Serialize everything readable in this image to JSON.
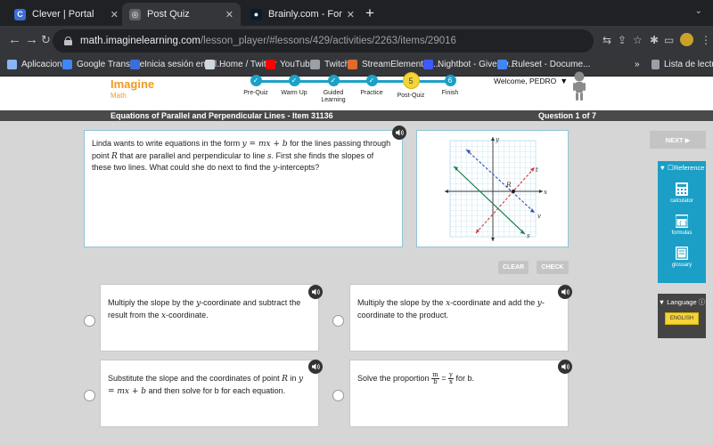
{
  "browser": {
    "tabs": [
      {
        "title": "Clever | Portal",
        "favicon_color": "#3a6fd9",
        "favicon_letter": "C"
      },
      {
        "title": "Post Quiz",
        "favicon_color": "#5f6368",
        "favicon_letter": ""
      },
      {
        "title": "Brainly.com - For students. By",
        "favicon_color": "#0b1b2c",
        "favicon_letter": ""
      }
    ],
    "url_host": "math.imaginelearning.com",
    "url_path": "/lesson_player/#lessons/429/activities/2263/items/29016",
    "bookmarks": [
      {
        "label": "Aplicaciones",
        "color": "#8ab4f8"
      },
      {
        "label": "Google Translate",
        "color": "#4285f4"
      },
      {
        "label": "Inicia sesión en Cl...",
        "color": "#3a6fd9"
      },
      {
        "label": "Home / Twitter",
        "color": "#cfd8dc"
      },
      {
        "label": "YouTube",
        "color": "#ff0000"
      },
      {
        "label": "Twitch",
        "color": "#9aa0a6"
      },
      {
        "label": "StreamElements -...",
        "color": "#e06b2b"
      },
      {
        "label": "Nightbot - Giveaw...",
        "color": "#3d5afe"
      },
      {
        "label": "Ruleset - Docume...",
        "color": "#4285f4"
      }
    ],
    "bookmarks_overflow": "»",
    "reading_list": "Lista de lectura"
  },
  "app": {
    "logo_line1": "Imagine",
    "logo_line2": "Math",
    "steps": [
      {
        "label": "Pre-Quiz",
        "state": "done",
        "mark": "✓"
      },
      {
        "label": "Warm Up",
        "state": "done",
        "mark": "✓"
      },
      {
        "label": "Guided Learning",
        "state": "done",
        "mark": "✓"
      },
      {
        "label": "Practice",
        "state": "done",
        "mark": "✓"
      },
      {
        "label": "Post-Quiz",
        "state": "current",
        "mark": "5"
      },
      {
        "label": "Finish",
        "state": "todo",
        "mark": "6"
      }
    ],
    "welcome": "Welcome, PEDRO",
    "lesson_title": "Equations of Parallel and Perpendicular Lines - Item 31136",
    "question_counter": "Question 1 of 7"
  },
  "question": {
    "parts": [
      "Linda wants to write equations in the form ",
      "y = mx + b",
      " for the lines passing through point ",
      "R",
      " that are parallel and perpendicular to line ",
      "s",
      ". First she finds the slopes of these two lines. What could she do next to find the ",
      "y",
      "-intercepts?"
    ]
  },
  "graph": {
    "axis_x_label": "x",
    "axis_y_label": "y",
    "point_label": "R",
    "line_labels": [
      "t",
      "v",
      "s"
    ],
    "line_colors": {
      "t": "#d23a3a",
      "v": "#3a4fa8",
      "s": "#1f7a4a"
    }
  },
  "controls": {
    "clear": "CLEAR",
    "check": "CHECK",
    "next": "NEXT ▶"
  },
  "answers": [
    {
      "parts": [
        "Multiply the slope by the ",
        "y",
        "-coordinate and subtract the result from the ",
        "x",
        "-coordinate."
      ]
    },
    {
      "parts": [
        "Multiply the slope by the ",
        "x",
        "-coordinate and add the ",
        "y",
        "-coordinate to the product."
      ]
    },
    {
      "parts": [
        "Substitute the slope and the coordinates of point ",
        "R",
        " in ",
        "y = mx + b",
        " and then solve for b for each equation."
      ]
    },
    {
      "before": "Solve the proportion ",
      "frac1_num": "m",
      "frac1_den": "b",
      "eq": " = ",
      "frac2_num": "y",
      "frac2_den": "x",
      "after": " for b."
    }
  ],
  "sidebar": {
    "reference": "Reference",
    "items": [
      "calculator",
      "formulas",
      "glossary"
    ],
    "language": "Language",
    "language_btn": "ENGLISH"
  }
}
